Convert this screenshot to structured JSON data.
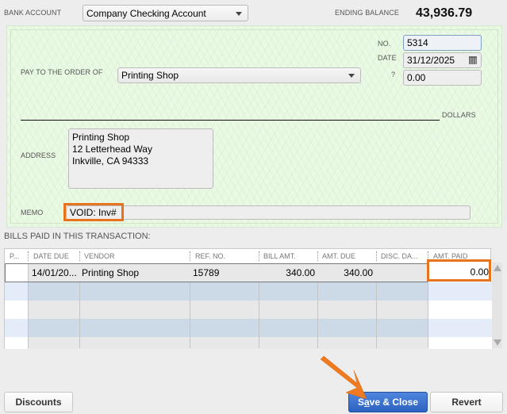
{
  "header": {
    "bank_account_label": "BANK ACCOUNT",
    "bank_account_value": "Company Checking Account",
    "ending_balance_label": "ENDING BALANCE",
    "ending_balance_value": "43,936.79"
  },
  "check": {
    "no_label": "NO.",
    "no_value": "5314",
    "date_label": "DATE",
    "date_value": "31/12/2025",
    "amount_label": "?",
    "amount_value": "0.00",
    "pay_to_label": "PAY TO THE ORDER OF",
    "pay_to_value": "Printing Shop",
    "dollars_label": "DOLLARS",
    "address_label": "ADDRESS",
    "address_lines": "Printing Shop\n12 Letterhead Way\nInkville, CA 94333",
    "memo_label": "MEMO",
    "memo_value": "VOID: Inv#"
  },
  "bills": {
    "title": "BILLS PAID IN THIS TRANSACTION:",
    "columns": [
      "P...",
      "DATE DUE",
      "VENDOR",
      "REF. NO.",
      "BILL AMT.",
      "AMT. DUE",
      "DISC. DA...",
      "AMT. PAID"
    ],
    "rows": [
      {
        "p": "",
        "date_due": "14/01/20...",
        "vendor": "Printing Shop",
        "ref_no": "15789",
        "bill_amt": "340.00",
        "amt_due": "340.00",
        "disc_date": "",
        "amt_paid": "0.00"
      }
    ]
  },
  "buttons": {
    "discounts": "Discounts",
    "save_close_pre": "S",
    "save_close_u": "a",
    "save_close_post": "ve & Close",
    "revert": "Revert"
  },
  "annotation_color": "#e8731e"
}
